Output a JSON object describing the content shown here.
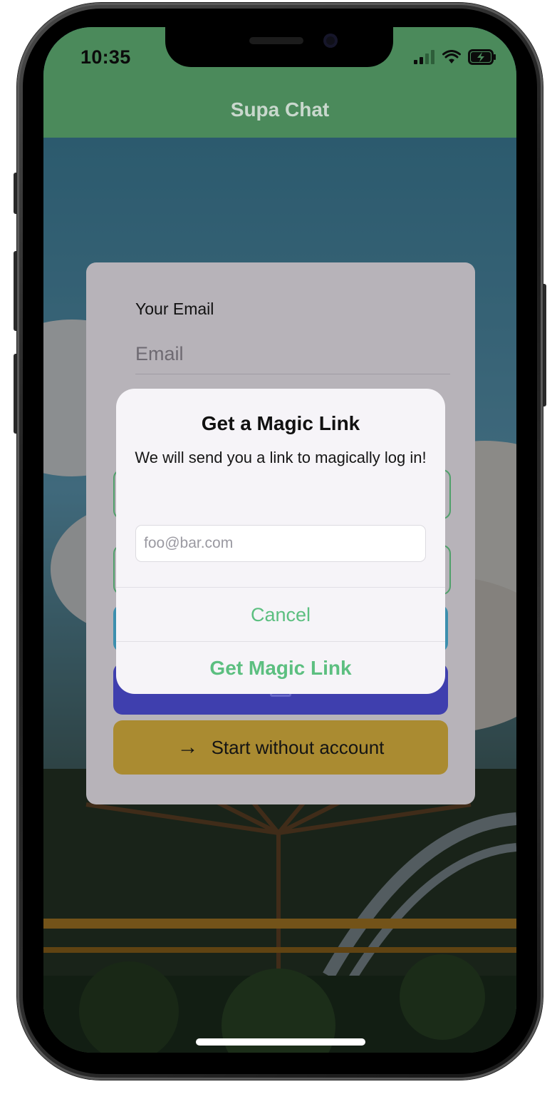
{
  "status_bar": {
    "time": "10:35",
    "icons": [
      "signal-icon",
      "wifi-icon",
      "battery-charging-icon"
    ]
  },
  "header": {
    "title": "Supa Chat",
    "color": "#4b8a5b"
  },
  "login_card": {
    "email_label": "Your Email",
    "email_placeholder": "Email",
    "start_without_account_label": "Start without account",
    "start_button_color": "#aa8b31",
    "magic_link_button_color": "#3f3fae"
  },
  "alert": {
    "title": "Get a Magic Link",
    "message": "We will send you a link to magically log in!",
    "input_placeholder": "foo@bar.com",
    "cancel_label": "Cancel",
    "confirm_label": "Get Magic Link",
    "accent_color": "#5cbf80"
  }
}
